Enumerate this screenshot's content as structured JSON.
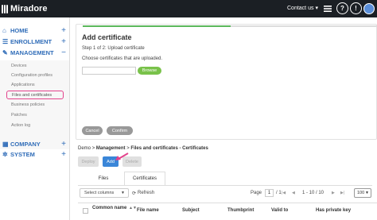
{
  "topbar": {
    "brand": "Miradore",
    "contact": "Contact us",
    "contact_caret": "▾",
    "icons": [
      "contact-caret-icon",
      "menu-icon",
      "help-icon",
      "info-icon",
      "user-avatar"
    ]
  },
  "sidebar": {
    "main_items": [
      {
        "icon": "home-icon",
        "glyph": "⌂",
        "label": "HOME",
        "toggle": "+"
      },
      {
        "icon": "enrollment-icon",
        "glyph": "☰",
        "label": "ENROLLMENT",
        "toggle": "+"
      },
      {
        "icon": "wrench-icon",
        "glyph": "✎",
        "label": "MANAGEMENT",
        "toggle": "−"
      },
      {
        "icon": "building-icon",
        "glyph": "▦",
        "label": "COMPANY",
        "toggle": "+"
      },
      {
        "icon": "gear-icon",
        "glyph": "✲",
        "label": "SYSTEM",
        "toggle": "+"
      }
    ],
    "sub_items": [
      "Devices",
      "Configuration profiles",
      "Applications",
      "Files and certificates",
      "Business policies",
      "Patches",
      "Action log"
    ],
    "active_sub": "Files and certificates"
  },
  "dialog": {
    "title": "Add certificate",
    "step": "Step 1 of 2: Upload certificate",
    "prompt": "Choose certificates that are uploaded.",
    "file_value": "",
    "browse_label": "Browse",
    "cancel_label": "Cancel",
    "confirm_label": "Confirm",
    "progress_fraction": 0.5
  },
  "breadcrumb": {
    "root": "Demo",
    "sep": ">",
    "section": "Management",
    "page": "Files and certificates - Certificates"
  },
  "toolbar": {
    "deploy_label": "Deploy",
    "add_label": "Add",
    "delete_label": "Delete"
  },
  "tabs": [
    {
      "label": "Files",
      "active": false
    },
    {
      "label": "Certificates",
      "active": true
    }
  ],
  "grid": {
    "select_columns": "Select columns",
    "refresh": "Refresh",
    "page_label": "Page",
    "page_value": "1",
    "page_of": "/ 1",
    "range": "1 - 10 / 10",
    "page_size": "100",
    "nav_first": "|◀",
    "nav_prev": "◀",
    "nav_next": "▶",
    "nav_last": "▶|",
    "columns": [
      "Common name",
      "File name",
      "Subject",
      "Thumbprint",
      "Valid to",
      "Has private key"
    ]
  },
  "colors": {
    "accent": "#3a86d8",
    "nav": "#2f6cb8",
    "browse": "#79c24a",
    "progress": "#5cb85c",
    "highlight": "#e3428c"
  }
}
